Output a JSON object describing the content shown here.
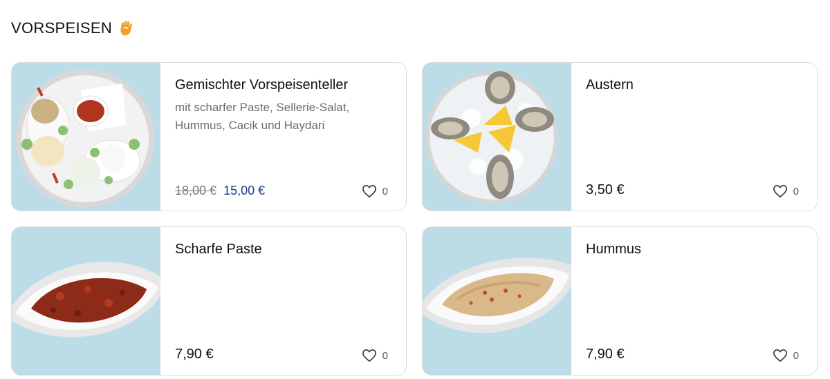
{
  "section": {
    "title": "VORSPEISEN",
    "icon": "hand-icon",
    "icon_color": "#f0a030"
  },
  "colors": {
    "new_price": "#1c3f8a",
    "image_background": "#bcdce8",
    "card_border": "#dcdcdc"
  },
  "products": [
    {
      "name": "Gemischter Vorspeisenteller",
      "description": "mit scharfer Paste, Sellerie-Salat, Hummus, Cacik und Haydari",
      "old_price": "18,00 €",
      "price": "15,00 €",
      "likes": "0",
      "image": "mixed-appetizer-plate"
    },
    {
      "name": "Austern",
      "description": "",
      "price": "3,50 €",
      "likes": "0",
      "image": "oysters-on-ice"
    },
    {
      "name": "Scharfe Paste",
      "description": "",
      "price": "7,90 €",
      "likes": "0",
      "image": "spicy-paste-bowl"
    },
    {
      "name": "Hummus",
      "description": "",
      "price": "7,90 €",
      "likes": "0",
      "image": "hummus-bowl"
    }
  ]
}
